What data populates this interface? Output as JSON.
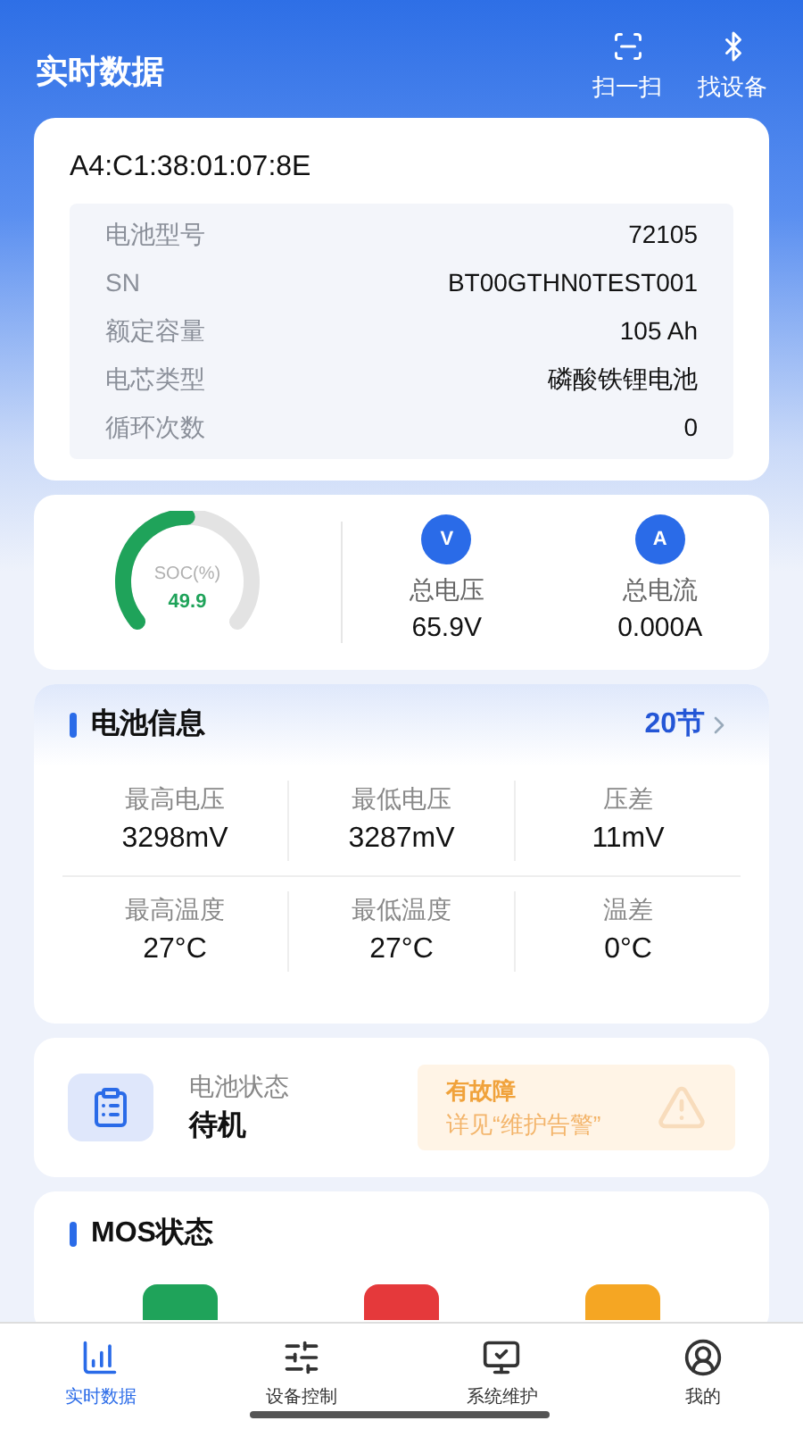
{
  "header": {
    "title": "实时数据",
    "actions": [
      {
        "kind": "scan",
        "label": "扫一扫"
      },
      {
        "kind": "bluetooth",
        "label": "找设备"
      }
    ]
  },
  "device": {
    "mac": "A4:C1:38:01:07:8E",
    "rows": [
      {
        "label": "电池型号",
        "value": "72105"
      },
      {
        "label": "SN",
        "value": "BT00GTHN0TEST001"
      },
      {
        "label": "额定容量",
        "value": "105 Ah"
      },
      {
        "label": "电芯类型",
        "value": "磷酸铁锂电池"
      },
      {
        "label": "循环次数",
        "value": "0"
      }
    ]
  },
  "soc": {
    "label": "SOC(%)",
    "value": "49.9"
  },
  "totals": [
    {
      "icon_letter": "V",
      "label": "总电压",
      "value": "65.9V"
    },
    {
      "icon_letter": "A",
      "label": "总电流",
      "value": "0.000A"
    }
  ],
  "battery_info": {
    "title": "电池信息",
    "count": "20节",
    "rows": [
      [
        {
          "label": "最高电压",
          "value": "3298mV"
        },
        {
          "label": "最低电压",
          "value": "3287mV"
        },
        {
          "label": "压差",
          "value": "11mV"
        }
      ],
      [
        {
          "label": "最高温度",
          "value": "27°C"
        },
        {
          "label": "最低温度",
          "value": "27°C"
        },
        {
          "label": "温差",
          "value": "0°C"
        }
      ]
    ]
  },
  "battery_status": {
    "label": "电池状态",
    "value": "待机",
    "fault": {
      "title": "有故障",
      "detail": "详见“维护告警”"
    }
  },
  "mos": {
    "title": "MOS状态",
    "items": [
      {
        "color": "#1fa35a"
      },
      {
        "color": "#e5393b"
      },
      {
        "color": "#f5a623"
      }
    ]
  },
  "tabs": [
    {
      "kind": "chart",
      "label": "实时数据",
      "selected": true
    },
    {
      "kind": "control",
      "label": "设备控制",
      "selected": false
    },
    {
      "kind": "maintain",
      "label": "系统维护",
      "selected": false
    },
    {
      "kind": "user",
      "label": "我的",
      "selected": false
    }
  ]
}
